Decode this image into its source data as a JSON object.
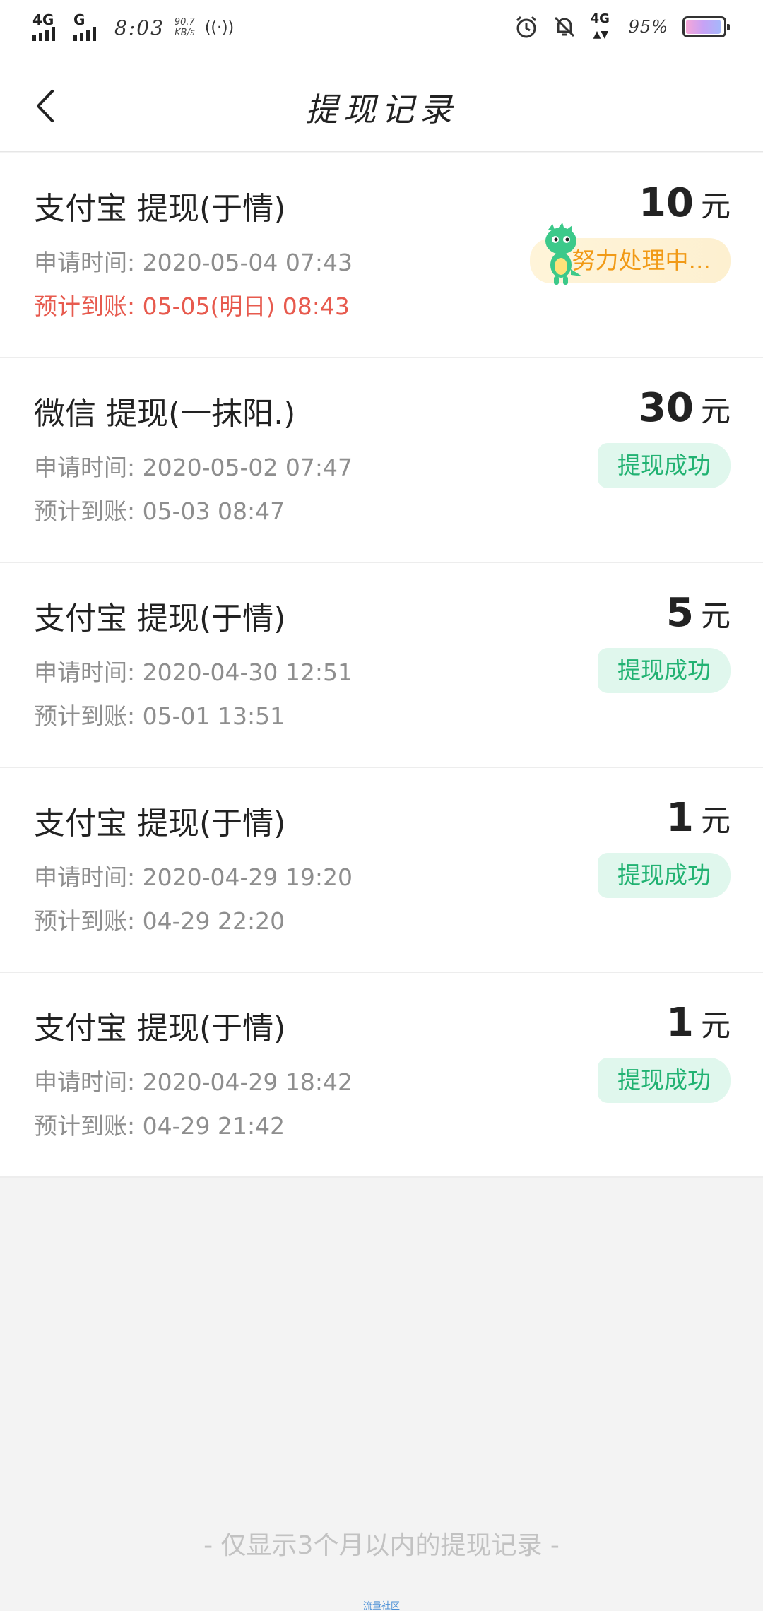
{
  "status_bar": {
    "network1": "4G",
    "network2": "G",
    "time": "8:03",
    "speed_value": "90.7",
    "speed_unit": "KB/s",
    "battery_pct": "95%",
    "battery_level": 0.95
  },
  "header": {
    "title": "提现记录"
  },
  "records": [
    {
      "title": "支付宝 提现(于情)",
      "apply": "申请时间: 2020-05-04 07:43",
      "expect": "预计到账: 05-05(明日) 08:43",
      "amount": "10",
      "unit": "元",
      "status": "努力处理中..."
    },
    {
      "title": "微信 提现(一抹阳.)",
      "apply": "申请时间: 2020-05-02 07:47",
      "expect": "预计到账: 05-03 08:47",
      "amount": "30",
      "unit": "元",
      "status": "提现成功"
    },
    {
      "title": "支付宝 提现(于情)",
      "apply": "申请时间: 2020-04-30 12:51",
      "expect": "预计到账: 05-01 13:51",
      "amount": "5",
      "unit": "元",
      "status": "提现成功"
    },
    {
      "title": "支付宝 提现(于情)",
      "apply": "申请时间: 2020-04-29 19:20",
      "expect": "预计到账: 04-29 22:20",
      "amount": "1",
      "unit": "元",
      "status": "提现成功"
    },
    {
      "title": "支付宝 提现(于情)",
      "apply": "申请时间: 2020-04-29 18:42",
      "expect": "预计到账: 04-29 21:42",
      "amount": "1",
      "unit": "元",
      "status": "提现成功"
    }
  ],
  "footer_note": "- 仅显示3个月以内的提现记录 -",
  "watermark": "流量社区",
  "colors": {
    "success_text": "#21b272",
    "success_bg": "#e0f7ed",
    "pending_text": "#f19a16",
    "urgent_text": "#e75a4e"
  }
}
